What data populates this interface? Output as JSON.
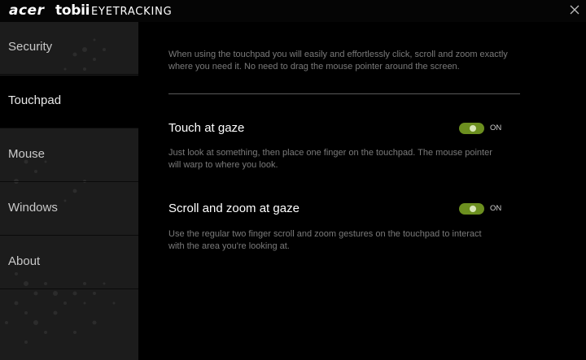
{
  "window": {
    "brand_primary": "acer",
    "brand_secondary": "tobii",
    "brand_product": "EYETRACKING",
    "close_icon": "close-icon"
  },
  "sidebar": {
    "items": [
      {
        "label": "Security",
        "active": false
      },
      {
        "label": "Touchpad",
        "active": true
      },
      {
        "label": "Mouse",
        "active": false
      },
      {
        "label": "Windows",
        "active": false
      },
      {
        "label": "About",
        "active": false
      }
    ]
  },
  "main": {
    "intro": "When using the touchpad you will easily and effortlessly click, scroll and zoom exactly where you need it. No need to drag the mouse pointer around the screen.",
    "settings": [
      {
        "title": "Touch at gaze",
        "description": "Just look at something, then place one finger on the touchpad. The mouse pointer will warp to where you look.",
        "toggle_state": "ON"
      },
      {
        "title": "Scroll and zoom at gaze",
        "description": "Use the regular two finger scroll and zoom gestures on the touchpad to interact with the area you're looking at.",
        "toggle_state": "ON"
      }
    ]
  },
  "colors": {
    "accent_toggle": "#6c8f1f",
    "sidebar_bg": "#1c1c1c",
    "active_bg": "#000000"
  }
}
